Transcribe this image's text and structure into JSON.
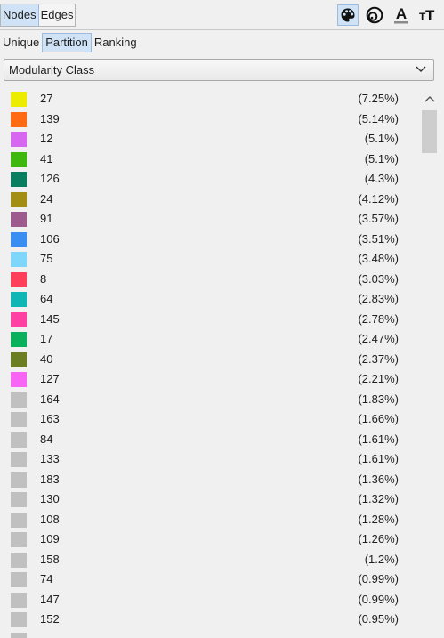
{
  "tabs": {
    "nodes": "Nodes",
    "edges": "Edges"
  },
  "tools": [
    "palette-icon",
    "size-icon",
    "label-color-icon",
    "label-size-icon"
  ],
  "subtabs": {
    "unique": "Unique",
    "partition": "Partition",
    "ranking": "Ranking"
  },
  "attribute": {
    "selected": "Modularity Class"
  },
  "colors": {
    "accent": "#cfe2f6",
    "grey_swatch": "#c0c0c0"
  },
  "partitions": [
    {
      "label": "27",
      "percent": "(7.25%)",
      "color": "#ecec00"
    },
    {
      "label": "139",
      "percent": "(5.14%)",
      "color": "#ff6a12"
    },
    {
      "label": "12",
      "percent": "(5.1%)",
      "color": "#d766f0"
    },
    {
      "label": "41",
      "percent": "(5.1%)",
      "color": "#3fb80e"
    },
    {
      "label": "126",
      "percent": "(4.3%)",
      "color": "#087d60"
    },
    {
      "label": "24",
      "percent": "(4.12%)",
      "color": "#a38d12"
    },
    {
      "label": "91",
      "percent": "(3.57%)",
      "color": "#9c5b8c"
    },
    {
      "label": "106",
      "percent": "(3.51%)",
      "color": "#3a8ef2"
    },
    {
      "label": "75",
      "percent": "(3.48%)",
      "color": "#7ed6fb"
    },
    {
      "label": "8",
      "percent": "(3.03%)",
      "color": "#ff3f59"
    },
    {
      "label": "64",
      "percent": "(2.83%)",
      "color": "#10b5b5"
    },
    {
      "label": "145",
      "percent": "(2.78%)",
      "color": "#ff3fa1"
    },
    {
      "label": "17",
      "percent": "(2.47%)",
      "color": "#0bb05c"
    },
    {
      "label": "40",
      "percent": "(2.37%)",
      "color": "#6b7f22"
    },
    {
      "label": "127",
      "percent": "(2.21%)",
      "color": "#f864f3"
    },
    {
      "label": "164",
      "percent": "(1.83%)",
      "color": "#c0c0c0"
    },
    {
      "label": "163",
      "percent": "(1.66%)",
      "color": "#c0c0c0"
    },
    {
      "label": "84",
      "percent": "(1.61%)",
      "color": "#c0c0c0"
    },
    {
      "label": "133",
      "percent": "(1.61%)",
      "color": "#c0c0c0"
    },
    {
      "label": "183",
      "percent": "(1.36%)",
      "color": "#c0c0c0"
    },
    {
      "label": "130",
      "percent": "(1.32%)",
      "color": "#c0c0c0"
    },
    {
      "label": "108",
      "percent": "(1.28%)",
      "color": "#c0c0c0"
    },
    {
      "label": "109",
      "percent": "(1.26%)",
      "color": "#c0c0c0"
    },
    {
      "label": "158",
      "percent": "(1.2%)",
      "color": "#c0c0c0"
    },
    {
      "label": "74",
      "percent": "(0.99%)",
      "color": "#c0c0c0"
    },
    {
      "label": "147",
      "percent": "(0.99%)",
      "color": "#c0c0c0"
    },
    {
      "label": "152",
      "percent": "(0.95%)",
      "color": "#c0c0c0"
    },
    {
      "label": "",
      "percent": "",
      "color": "#c0c0c0"
    }
  ]
}
